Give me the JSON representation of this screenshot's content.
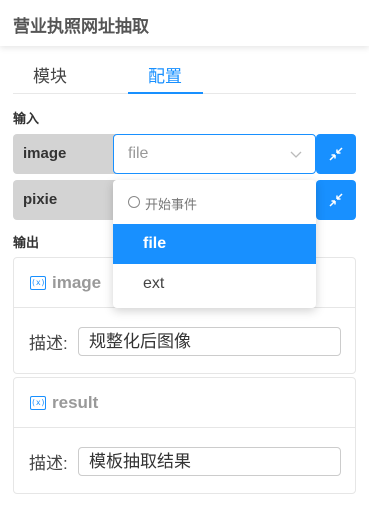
{
  "header": {
    "title": "营业执照网址抽取"
  },
  "tabs": [
    {
      "label": "模块"
    },
    {
      "label": "配置"
    }
  ],
  "inputs": {
    "section_label": "输入",
    "params": [
      {
        "name": "image",
        "selected_value": "file"
      },
      {
        "name": "pixie"
      }
    ]
  },
  "dropdown": {
    "group_label": "开始事件",
    "options": [
      {
        "label": "file"
      },
      {
        "label": "ext"
      }
    ],
    "selected": "file"
  },
  "outputs": {
    "section_label": "输出",
    "items": [
      {
        "icon": "variable-icon",
        "icon_text": "(x)",
        "name": "image",
        "desc_label": "描述:",
        "desc_value": "规整化后图像"
      },
      {
        "icon": "variable-icon",
        "icon_text": "(x)",
        "name": "result",
        "desc_label": "描述:",
        "desc_value": "模板抽取结果"
      }
    ]
  },
  "colors": {
    "accent": "#1890ff",
    "param_bg": "#d3d3d3",
    "muted": "#999999"
  }
}
